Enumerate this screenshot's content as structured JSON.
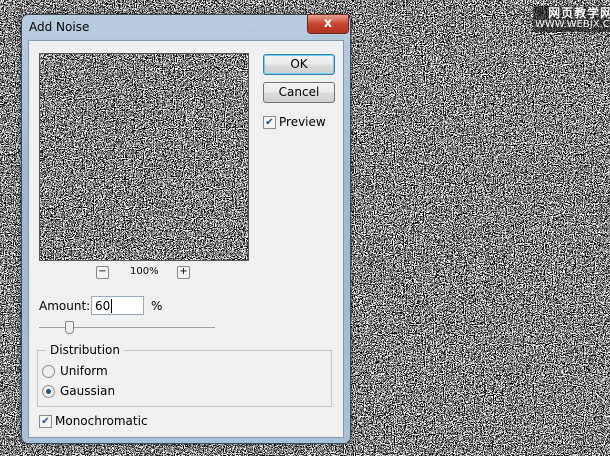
{
  "watermark": {
    "line1": "网页教学网",
    "line2": "WWW.WEBJX.COM"
  },
  "dialog": {
    "title": "Add Noise",
    "close_label": "x",
    "ok_label": "OK",
    "cancel_label": "Cancel",
    "preview_label": "Preview",
    "preview_checked": true,
    "zoom_level": "100%",
    "zoom_out_label": "−",
    "zoom_in_label": "+",
    "amount_label": "Amount:",
    "amount_value": "60",
    "amount_unit": "%",
    "distribution_label": "Distribution",
    "uniform_label": "Uniform",
    "gaussian_label": "Gaussian",
    "selected_distribution": "Gaussian",
    "monochromatic_label": "Monochromatic",
    "monochromatic_checked": true
  }
}
